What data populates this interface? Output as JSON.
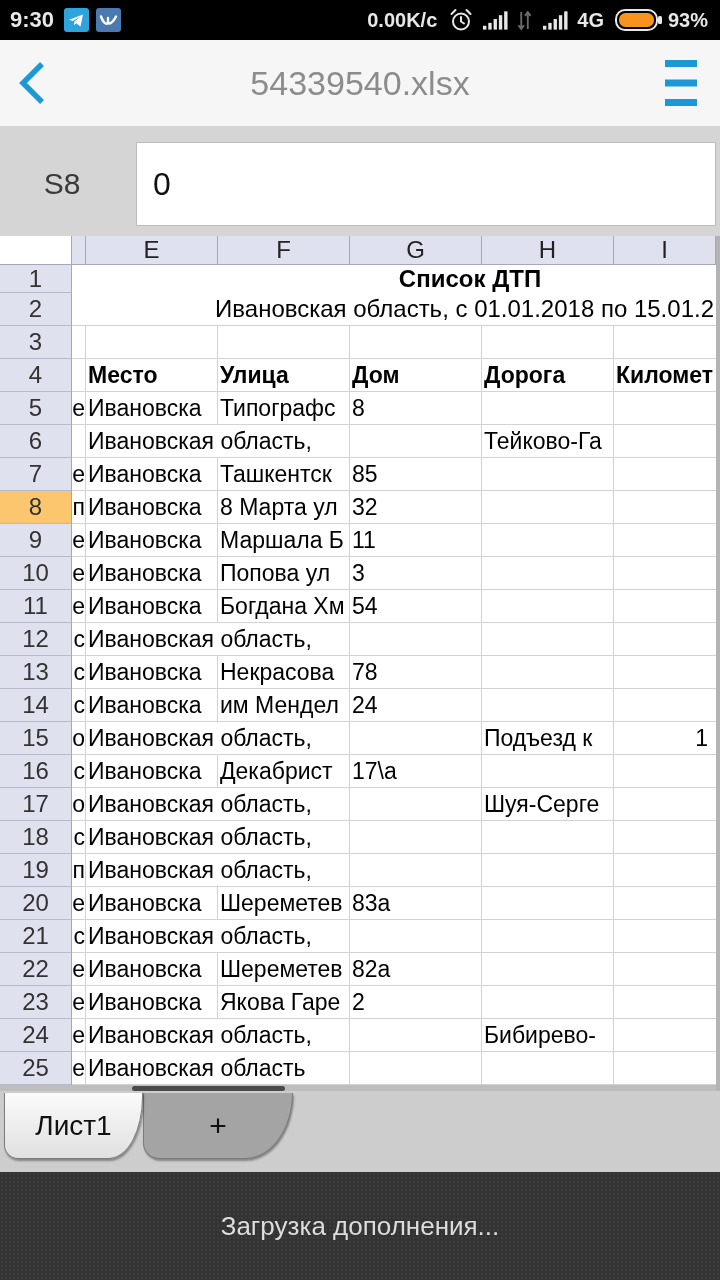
{
  "status_bar": {
    "time": "9:30",
    "network_speed": "0.00K/c",
    "network_type": "4G",
    "battery": "93%"
  },
  "toolbar": {
    "title": "54339540.xlsx"
  },
  "formula_bar": {
    "cell_reference": "S8",
    "value": "0"
  },
  "sheet": {
    "columns": [
      "E",
      "F",
      "G",
      "H",
      "I"
    ],
    "rows": [
      {
        "number": "1",
        "selected": false,
        "kind": "title",
        "text": "Список ДТП"
      },
      {
        "number": "2",
        "selected": false,
        "kind": "subtitle",
        "text": "Ивановская область, с 01.01.2018 по 15.01.2"
      },
      {
        "number": "3",
        "selected": false,
        "kind": "data"
      },
      {
        "number": "4",
        "selected": false,
        "kind": "header",
        "cells": {
          "e": "Место",
          "f": "Улица",
          "g": "Дом",
          "h": "Дорога",
          "i": "Километ"
        }
      },
      {
        "number": "5",
        "selected": false,
        "kind": "data",
        "cells": {
          "column_d": "е",
          "e": "Ивановска",
          "f": "Типографс",
          "g": "8"
        }
      },
      {
        "number": "6",
        "selected": false,
        "kind": "data",
        "cells": {
          "e": "Ивановская область,",
          "h": "Тейково-Га"
        }
      },
      {
        "number": "7",
        "selected": false,
        "kind": "data",
        "cells": {
          "column_d": "е",
          "e": "Ивановска",
          "f": "Ташкентск",
          "g": "85"
        }
      },
      {
        "number": "8",
        "selected": true,
        "kind": "data",
        "cells": {
          "column_d": "п",
          "e": "Ивановска",
          "f": "8 Марта ул",
          "g": "32"
        }
      },
      {
        "number": "9",
        "selected": false,
        "kind": "data",
        "cells": {
          "column_d": "е",
          "e": "Ивановска",
          "f": "Маршала Б",
          "g": "11"
        }
      },
      {
        "number": "10",
        "selected": false,
        "kind": "data",
        "cells": {
          "column_d": "е",
          "e": "Ивановска",
          "f": "Попова ул",
          "g": "3"
        }
      },
      {
        "number": "11",
        "selected": false,
        "kind": "data",
        "cells": {
          "column_d": "е",
          "e": "Ивановска",
          "f": "Богдана Хм",
          "g": "54"
        }
      },
      {
        "number": "12",
        "selected": false,
        "kind": "data",
        "cells": {
          "column_d": "с",
          "e": "Ивановская область,"
        }
      },
      {
        "number": "13",
        "selected": false,
        "kind": "data",
        "cells": {
          "column_d": "с",
          "e": "Ивановска",
          "f": "Некрасова",
          "g": "78"
        }
      },
      {
        "number": "14",
        "selected": false,
        "kind": "data",
        "cells": {
          "column_d": "с",
          "e": "Ивановска",
          "f": "им Мендел",
          "g": "24"
        }
      },
      {
        "number": "15",
        "selected": false,
        "kind": "data",
        "cells": {
          "column_d": "о",
          "e": "Ивановская область,",
          "h": "Подъезд к",
          "i": "1"
        }
      },
      {
        "number": "16",
        "selected": false,
        "kind": "data",
        "cells": {
          "column_d": "с",
          "e": "Ивановска",
          "f": "Декабрист",
          "g": "17\\а"
        }
      },
      {
        "number": "17",
        "selected": false,
        "kind": "data",
        "cells": {
          "column_d": "о",
          "e": "Ивановская область,",
          "h": "Шуя-Серге"
        }
      },
      {
        "number": "18",
        "selected": false,
        "kind": "data",
        "cells": {
          "column_d": "с",
          "e": "Ивановская область,"
        }
      },
      {
        "number": "19",
        "selected": false,
        "kind": "data",
        "cells": {
          "column_d": "п",
          "e": "Ивановская область,"
        }
      },
      {
        "number": "20",
        "selected": false,
        "kind": "data",
        "cells": {
          "column_d": "е",
          "e": "Ивановска",
          "f": "Шереметев",
          "g": "83а"
        }
      },
      {
        "number": "21",
        "selected": false,
        "kind": "data",
        "cells": {
          "column_d": "с",
          "e": "Ивановская область,"
        }
      },
      {
        "number": "22",
        "selected": false,
        "kind": "data",
        "cells": {
          "column_d": "е",
          "e": "Ивановска",
          "f": "Шереметев",
          "g": "82а"
        }
      },
      {
        "number": "23",
        "selected": false,
        "kind": "data",
        "cells": {
          "column_d": "е",
          "e": "Ивановска",
          "f": "Якова Гаре",
          "g": "2"
        }
      },
      {
        "number": "24",
        "selected": false,
        "kind": "data",
        "cells": {
          "column_d": "е",
          "e": "Ивановская область,",
          "h": "Бибирево-"
        }
      },
      {
        "number": "25",
        "selected": false,
        "kind": "data",
        "cells": {
          "column_d": "е",
          "e": "Ивановская область"
        }
      }
    ]
  },
  "sheet_tabs": [
    {
      "label": "Лист1",
      "selected": true
    }
  ],
  "add_sheet_tab": {
    "label": "+"
  },
  "notification": {
    "text": "Загрузка дополнения..."
  }
}
